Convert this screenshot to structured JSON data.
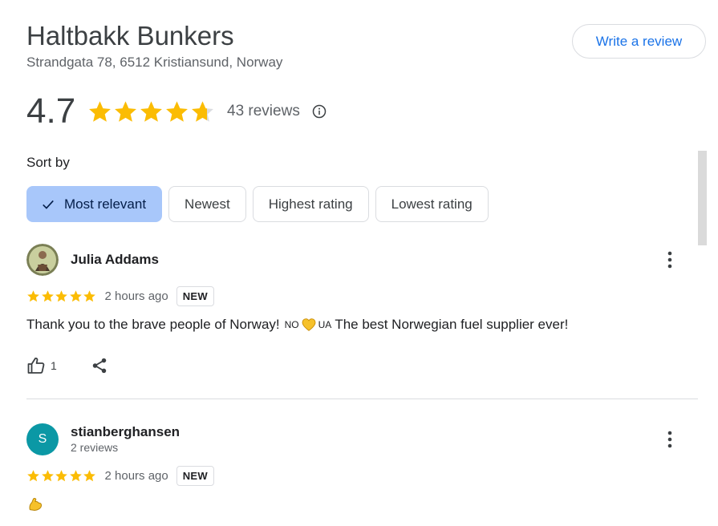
{
  "place": {
    "name": "Haltbakk Bunkers",
    "address": "Strandgata 78, 6512 Kristiansund, Norway",
    "rating": "4.7",
    "stars": 4.7,
    "review_count": "43 reviews",
    "write_review_label": "Write a review"
  },
  "sort": {
    "label": "Sort by",
    "options": [
      "Most relevant",
      "Newest",
      "Highest rating",
      "Lowest rating"
    ],
    "selected": "Most relevant"
  },
  "reviews": [
    {
      "name": "Julia Addams",
      "sub": "",
      "stars": 5,
      "time": "2 hours ago",
      "badge": "NEW",
      "text_before": "Thank you to the brave people of Norway!",
      "flag_left": "NO",
      "flag_right": "UA",
      "text_after": "The best Norwegian fuel supplier ever!",
      "likes": "1"
    },
    {
      "name": "stianberghansen",
      "sub": "2 reviews",
      "avatar_letter": "S",
      "stars": 5,
      "time": "2 hours ago",
      "badge": "NEW"
    }
  ],
  "colors": {
    "star": "#fbbc04",
    "star_empty": "#dadce0",
    "accent": "#1a73e8",
    "chip_active": "#a8c7fa",
    "avatar_teal": "#0b98a5"
  },
  "icons": {
    "info": "info-icon",
    "check": "check-icon",
    "more": "more-vert-icon",
    "like": "thumb-up-icon",
    "share": "share-icon",
    "heart": "yellow-heart-icon",
    "muscle": "flexed-biceps-icon"
  }
}
